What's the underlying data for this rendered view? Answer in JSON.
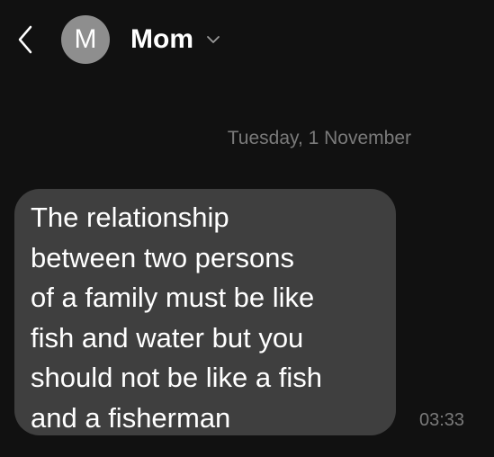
{
  "header": {
    "avatar_initial": "M",
    "contact_name": "Mom"
  },
  "conversation": {
    "date_divider": "Tuesday, 1 November",
    "messages": [
      {
        "text": "The relationship\nbetween two persons\nof a family must be like\nfish and water but you\nshould not be like a fish\nand a fisherman",
        "time": "03:33"
      }
    ]
  },
  "colors": {
    "background": "#111111",
    "bubble": "#3f3f3f",
    "avatar": "#8e8e8e",
    "secondary_text": "#7a7a7a"
  },
  "icons": {
    "back": "chevron-left-icon",
    "contact_menu": "chevron-down-icon"
  }
}
